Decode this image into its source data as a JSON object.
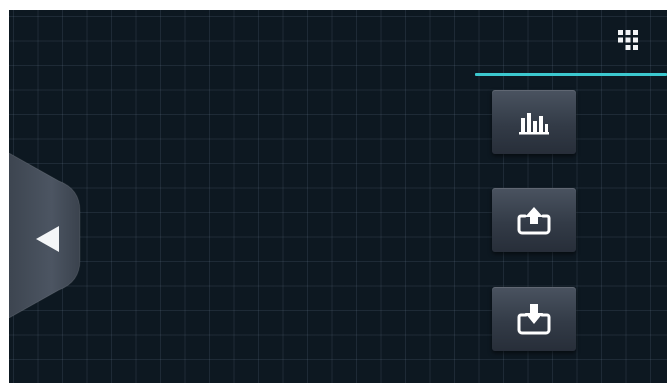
{
  "screen": {
    "background_color": "#0d1821",
    "accent_color": "#3cc8cf"
  },
  "top_right": {
    "menu_icon": "grid-menu-icon"
  },
  "side_buttons": [
    {
      "name": "stats-button",
      "icon": "bar-chart-icon"
    },
    {
      "name": "upload-button",
      "icon": "upload-tray-icon"
    },
    {
      "name": "download-button",
      "icon": "download-tray-icon"
    }
  ],
  "drawer": {
    "icon": "triangle-left-icon",
    "state": "collapsed"
  }
}
